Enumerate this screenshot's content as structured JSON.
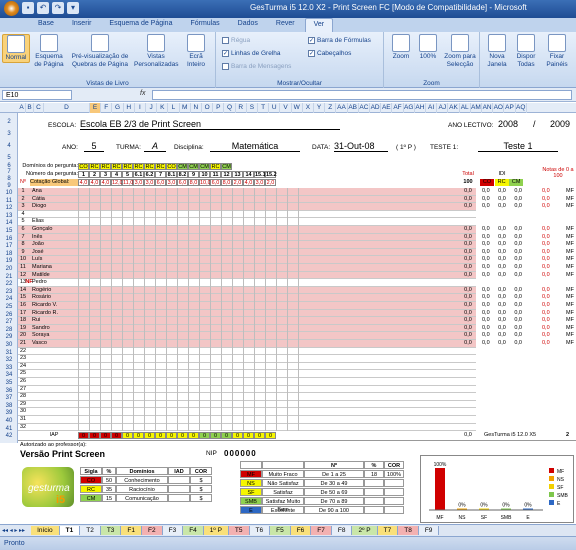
{
  "window": {
    "title": "GesTurma i5 12.0 X2 - Print Screen FC  [Modo de Compatibilidade] - Microsoft"
  },
  "ribbon_tabs": [
    "Base",
    "Inserir",
    "Esquema de Página",
    "Fórmulas",
    "Dados",
    "Rever",
    "Ver"
  ],
  "ribbon": {
    "workbook_views": {
      "label": "Vistas de Livro",
      "buttons": [
        "Normal",
        "Esquema de Página",
        "Pré-visualização de Quebras de Página",
        "Vistas Personalizadas",
        "Ecrã Inteiro"
      ]
    },
    "show_hide": {
      "label": "Mostrar/Ocultar",
      "options": [
        {
          "text": "Régua",
          "checked": false,
          "disabled": true
        },
        {
          "text": "Linhas de Grelha",
          "checked": true,
          "disabled": false
        },
        {
          "text": "Barra de Mensagens",
          "checked": false,
          "disabled": true
        },
        {
          "text": "Barra de Fórmulas",
          "checked": true,
          "disabled": false
        },
        {
          "text": "Cabeçalhos",
          "checked": true,
          "disabled": false
        }
      ]
    },
    "zoom": {
      "label": "Zoom",
      "buttons": [
        "Zoom",
        "100%",
        "Zoom para Selecção"
      ]
    },
    "window_group": {
      "buttons": [
        "Nova Janela",
        "Dispor Todas",
        "Fixar Painéis"
      ]
    }
  },
  "formula_bar": {
    "name_box": "E10",
    "fx": "fx",
    "value": ""
  },
  "columns": [
    "A",
    "B",
    "C",
    "D",
    "E",
    "F",
    "G",
    "H",
    "I",
    "J",
    "K",
    "L",
    "M",
    "N",
    "O",
    "P",
    "Q",
    "R",
    "S",
    "T",
    "U",
    "V",
    "W",
    "X",
    "Y",
    "Z",
    "AA",
    "AB",
    "AC",
    "AD",
    "AE",
    "AF",
    "AG",
    "AH",
    "AI",
    "AJ",
    "AK",
    "AL",
    "AM",
    "AN",
    "AO",
    "AP",
    "AQ"
  ],
  "header": {
    "escola_label": "ESCOLA:",
    "escola": "Escola EB 2/3 de Print Screen",
    "ano_lectivo_label": "ANO LECTIVO:",
    "ano_start": "2008",
    "slash": "/",
    "ano_end": "2009",
    "ano_label": "ANO:",
    "ano": "5",
    "turma_label": "TURMA:",
    "turma": "A",
    "disciplina_label": "Disciplina:",
    "disciplina": "Matemática",
    "data_label": "DATA:",
    "data": "31-Out-08",
    "periodo": "( 1º P )",
    "teste_label": "TESTE 1:",
    "teste": "Teste 1"
  },
  "grid_headers": {
    "dominios": "Domínios do pergunta:",
    "numero": "Número da pergunta:",
    "cotacao": "Cotação Global:",
    "no_label": "Nº",
    "nf_label": "Nº",
    "total": "Total",
    "total_value": "100",
    "idi": "IDI",
    "idi_cols": [
      "CO",
      "RC",
      "CM"
    ],
    "notas": "Notas de 0 a 100"
  },
  "domain_tags": [
    "CO",
    "RC",
    "RC",
    "RC",
    "RC",
    "RC",
    "RC",
    "RC",
    "CO",
    "CM",
    "CM",
    "CM",
    "RC",
    "CM"
  ],
  "question_numbers": [
    "1",
    "2",
    "3",
    "4",
    "5",
    "6.1",
    "6.2",
    "7",
    "8.1",
    "8.2",
    "9",
    "10",
    "11",
    "12",
    "13",
    "14",
    "15.1",
    "15.2"
  ],
  "cotacoes": [
    "4,0",
    "4,0",
    "4,0",
    "12,0",
    "11,0",
    "3,0",
    "3,0",
    "6,0",
    "3,0",
    "6,0",
    "8,0",
    "10,0",
    "6,0",
    "8,0",
    "2,0",
    "4,0",
    "3,0",
    "2,0"
  ],
  "students": [
    {
      "n": "1",
      "nf": "",
      "name": "Ana",
      "total": "0,0",
      "idi": [
        "0,0",
        "0,0",
        "0,0"
      ],
      "nota": "0,0",
      "nivel": "MF",
      "pink": true
    },
    {
      "n": "2",
      "nf": "",
      "name": "Cátia",
      "total": "0,0",
      "idi": [
        "0,0",
        "0,0",
        "0,0"
      ],
      "nota": "0,0",
      "nivel": "MF",
      "pink": true
    },
    {
      "n": "3",
      "nf": "",
      "name": "Diogo",
      "total": "0,0",
      "idi": [
        "0,0",
        "0,0",
        "0,0"
      ],
      "nota": "0,0",
      "nivel": "MF",
      "pink": true
    },
    {
      "n": "4",
      "nf": "",
      "name": "",
      "total": "",
      "idi": [
        "",
        "",
        ""
      ],
      "nota": "",
      "nivel": "",
      "pink": false
    },
    {
      "n": "5",
      "nf": "",
      "name": "Elias",
      "total": "",
      "idi": [
        "",
        "",
        ""
      ],
      "nota": "",
      "nivel": "",
      "pink": false
    },
    {
      "n": "6",
      "nf": "",
      "name": "Gonçalo",
      "total": "0,0",
      "idi": [
        "0,0",
        "0,0",
        "0,0"
      ],
      "nota": "0,0",
      "nivel": "MF",
      "pink": true
    },
    {
      "n": "7",
      "nf": "",
      "name": "Inês",
      "total": "0,0",
      "idi": [
        "0,0",
        "0,0",
        "0,0"
      ],
      "nota": "0,0",
      "nivel": "MF",
      "pink": true
    },
    {
      "n": "8",
      "nf": "",
      "name": "João",
      "total": "0,0",
      "idi": [
        "0,0",
        "0,0",
        "0,0"
      ],
      "nota": "0,0",
      "nivel": "MF",
      "pink": true
    },
    {
      "n": "9",
      "nf": "",
      "name": "José",
      "total": "0,0",
      "idi": [
        "0,0",
        "0,0",
        "0,0"
      ],
      "nota": "0,0",
      "nivel": "MF",
      "pink": true
    },
    {
      "n": "10",
      "nf": "",
      "name": "Luís",
      "total": "0,0",
      "idi": [
        "0,0",
        "0,0",
        "0,0"
      ],
      "nota": "0,0",
      "nivel": "MF",
      "pink": true
    },
    {
      "n": "11",
      "nf": "",
      "name": "Mariana",
      "total": "0,0",
      "idi": [
        "0,0",
        "0,0",
        "0,0"
      ],
      "nota": "0,0",
      "nivel": "MF",
      "pink": true
    },
    {
      "n": "12",
      "nf": "",
      "name": "Matilde",
      "total": "0,0",
      "idi": [
        "0,0",
        "0,0",
        "0,0"
      ],
      "nota": "0,0",
      "nivel": "MF",
      "pink": true
    },
    {
      "n": "13",
      "nf": "NF",
      "name": "Pedro",
      "total": "",
      "idi": [
        "",
        "",
        ""
      ],
      "nota": "",
      "nivel": "",
      "pink": false
    },
    {
      "n": "14",
      "nf": "",
      "name": "Rogério",
      "total": "0,0",
      "idi": [
        "0,0",
        "0,0",
        "0,0"
      ],
      "nota": "0,0",
      "nivel": "MF",
      "pink": true
    },
    {
      "n": "15",
      "nf": "",
      "name": "Rosário",
      "total": "0,0",
      "idi": [
        "0,0",
        "0,0",
        "0,0"
      ],
      "nota": "0,0",
      "nivel": "MF",
      "pink": true
    },
    {
      "n": "16",
      "nf": "",
      "name": "Ricardo V.",
      "total": "0,0",
      "idi": [
        "0,0",
        "0,0",
        "0,0"
      ],
      "nota": "0,0",
      "nivel": "MF",
      "pink": true
    },
    {
      "n": "17",
      "nf": "",
      "name": "Ricardo R.",
      "total": "0,0",
      "idi": [
        "0,0",
        "0,0",
        "0,0"
      ],
      "nota": "0,0",
      "nivel": "MF",
      "pink": true
    },
    {
      "n": "18",
      "nf": "",
      "name": "Rui",
      "total": "0,0",
      "idi": [
        "0,0",
        "0,0",
        "0,0"
      ],
      "nota": "0,0",
      "nivel": "MF",
      "pink": true
    },
    {
      "n": "19",
      "nf": "",
      "name": "Sandro",
      "total": "0,0",
      "idi": [
        "0,0",
        "0,0",
        "0,0"
      ],
      "nota": "0,0",
      "nivel": "MF",
      "pink": true
    },
    {
      "n": "20",
      "nf": "",
      "name": "Soraya",
      "total": "0,0",
      "idi": [
        "0,0",
        "0,0",
        "0,0"
      ],
      "nota": "0,0",
      "nivel": "MF",
      "pink": true
    },
    {
      "n": "21",
      "nf": "",
      "name": "Vasco",
      "total": "0,0",
      "idi": [
        "0,0",
        "0,0",
        "0,0"
      ],
      "nota": "0,0",
      "nivel": "MF",
      "pink": true
    },
    {
      "n": "22",
      "nf": "",
      "name": "",
      "total": "",
      "idi": [
        "",
        "",
        ""
      ],
      "nota": "",
      "nivel": "",
      "pink": false
    },
    {
      "n": "23",
      "nf": "",
      "name": "",
      "total": "",
      "idi": [
        "",
        "",
        ""
      ],
      "nota": "",
      "nivel": "",
      "pink": false
    },
    {
      "n": "24",
      "nf": "",
      "name": "",
      "total": "",
      "idi": [
        "",
        "",
        ""
      ],
      "nota": "",
      "nivel": "",
      "pink": false
    },
    {
      "n": "25",
      "nf": "",
      "name": "",
      "total": "",
      "idi": [
        "",
        "",
        ""
      ],
      "nota": "",
      "nivel": "",
      "pink": false
    },
    {
      "n": "26",
      "nf": "",
      "name": "",
      "total": "",
      "idi": [
        "",
        "",
        ""
      ],
      "nota": "",
      "nivel": "",
      "pink": false
    },
    {
      "n": "27",
      "nf": "",
      "name": "",
      "total": "",
      "idi": [
        "",
        "",
        ""
      ],
      "nota": "",
      "nivel": "",
      "pink": false
    },
    {
      "n": "28",
      "nf": "",
      "name": "",
      "total": "",
      "idi": [
        "",
        "",
        ""
      ],
      "nota": "",
      "nivel": "",
      "pink": false
    },
    {
      "n": "29",
      "nf": "",
      "name": "",
      "total": "",
      "idi": [
        "",
        "",
        ""
      ],
      "nota": "",
      "nivel": "",
      "pink": false
    },
    {
      "n": "30",
      "nf": "",
      "name": "",
      "total": "",
      "idi": [
        "",
        "",
        ""
      ],
      "nota": "",
      "nivel": "",
      "pink": false
    },
    {
      "n": "31",
      "nf": "",
      "name": "",
      "total": "",
      "idi": [
        "",
        "",
        ""
      ],
      "nota": "",
      "nivel": "",
      "pink": false
    },
    {
      "n": "32",
      "nf": "",
      "name": "",
      "total": "",
      "idi": [
        "",
        "",
        ""
      ],
      "nota": "",
      "nivel": "",
      "pink": false
    }
  ],
  "footer_row": {
    "label": "IAP",
    "values": [
      "0",
      "0",
      "0",
      "0",
      "0",
      "0",
      "0",
      "0",
      "0",
      "0",
      "0",
      "0",
      "0",
      "0",
      "0",
      "0",
      "0",
      "0"
    ],
    "total": "0,0",
    "brand": "GesTurma i5 12.0 X5",
    "badge": "2"
  },
  "bottom": {
    "autorizado": "Autorizado ao professor(a):",
    "versao": "Versão Print Screen",
    "nip_label": "NIP",
    "nip": "000000",
    "logo": "gesturma-i5",
    "dom_table": {
      "headers": [
        "Sigla",
        "%",
        "Domínios",
        "IAD",
        "COR"
      ],
      "rows": [
        [
          "CO",
          "50",
          "Conhecimento",
          "",
          "$"
        ],
        [
          "RC",
          "35",
          "Raciocínio",
          "",
          "$"
        ],
        [
          "CM",
          "15",
          "Comunicação",
          "",
          "$"
        ]
      ]
    },
    "lev_table": {
      "headers": [
        "",
        "",
        "Nº",
        "%",
        "COR"
      ],
      "rows": [
        [
          "MF",
          "Muito Fraco",
          "De 1 a 25",
          "18",
          "100%"
        ],
        [
          "NS",
          "Não Satisfaz",
          "De 30 a 49",
          "",
          ""
        ],
        [
          "SF",
          "Satisfaz",
          "De 50 a 69",
          "",
          ""
        ],
        [
          "SMB",
          "Satisfaz Muito Bem",
          "De 70 a 89",
          "",
          ""
        ],
        [
          "E",
          "Excelente",
          "De 90 a 100",
          "",
          ""
        ]
      ]
    },
    "chart_label": "100%"
  },
  "chart_data": {
    "type": "bar",
    "categories": [
      "MF",
      "NS",
      "SF",
      "SMB",
      "E"
    ],
    "values": [
      100,
      0,
      0,
      0,
      0
    ],
    "ylim": [
      0,
      100
    ],
    "data_labels": [
      "100%",
      "0%",
      "0%",
      "0%",
      "0%"
    ],
    "colors": [
      "#d00000",
      "#f2a200",
      "#f2d000",
      "#7dc64b",
      "#2d68c4"
    ]
  },
  "sheet_tabs": [
    "Início",
    "T1",
    "T2",
    "T3",
    "F1",
    "F2",
    "F3",
    "F4",
    "1º P",
    "T5",
    "T6",
    "F5",
    "F6",
    "F7",
    "F8",
    "2º P",
    "T7",
    "T8",
    "F9"
  ],
  "active_sheet": "T1",
  "status": "Pronto",
  "colors": {
    "pink": "#f3c6c6",
    "red": "#d00000",
    "yellow": "#f6f600",
    "green": "#8fd14f",
    "accent": "#1e4c93"
  }
}
